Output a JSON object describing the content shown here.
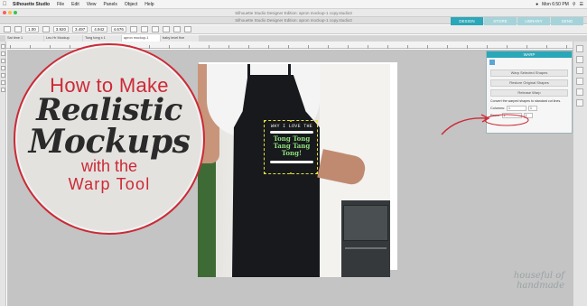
{
  "menubar": {
    "app": "Silhouette Studio",
    "items": [
      "File",
      "Edit",
      "View",
      "Panels",
      "Object",
      "Help"
    ],
    "clock": "Mon 6:50 PM"
  },
  "window": {
    "title_top": "Silhouette Studio Designer Edition: apron mockup-1 copy.studio3",
    "title_bottom": "Silhouette Studio Designer Edition: apron mockup-1 copy.studio3"
  },
  "modes": [
    {
      "label": "DESIGN",
      "active": true
    },
    {
      "label": "STORE",
      "active": false
    },
    {
      "label": "LIBRARY",
      "active": false
    },
    {
      "label": "SEND",
      "active": false
    }
  ],
  "toolbar": {
    "stroke": "1.00",
    "x": "3.920",
    "y": "3.497",
    "w": "4.942",
    "h": "4.676"
  },
  "doc_tabs": [
    {
      "label": "Sat time 1",
      "active": false
    },
    {
      "label": "Leo Hr Mockup",
      "active": false
    },
    {
      "label": "Tong tong x 1",
      "active": false
    },
    {
      "label": "apron mockup-1",
      "active": true
    },
    {
      "label": "baby level five",
      "active": false
    }
  ],
  "graphic": {
    "line1": "How to Make",
    "line2": "Realistic",
    "line3": "Mockups",
    "line4": "with the",
    "line5": "Warp Tool"
  },
  "design": {
    "top": "WHY I LOVE THE",
    "t1": "Tong Tong",
    "t2": "Tang Tang",
    "t3": "Tong!"
  },
  "panel": {
    "title": "WARP",
    "btn1": "Warp Selected Shapes",
    "btn2": "Restore Original Shapes",
    "btn3": "Release Warp",
    "note": "Convert the warped shapes to standard cut lines.",
    "row1_label": "Columns:",
    "row1_a": "1",
    "row1_b": "1",
    "row2_label": "Rows:",
    "row2_a": "1",
    "row2_b": "1"
  },
  "watermark": "houseful of handmade",
  "colors": {
    "accent": "#cc2a36",
    "teal": "#2aa7b8"
  }
}
